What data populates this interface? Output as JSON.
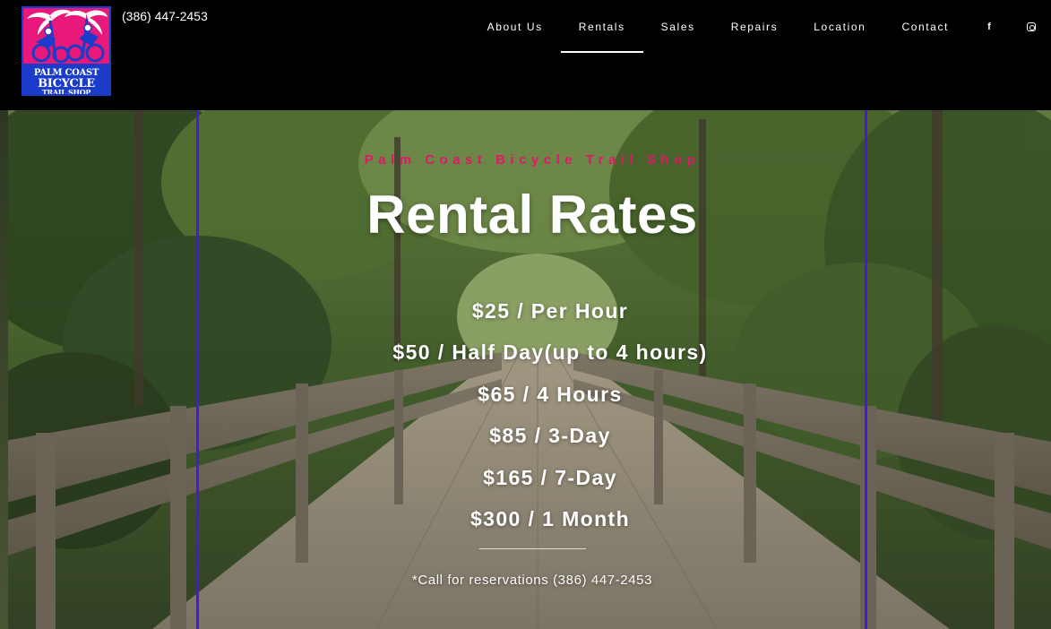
{
  "header": {
    "logo": {
      "line1": "PALM COAST",
      "line2": "BICYCLE",
      "line3": "TRAIL SHOP"
    },
    "phone": "(386) 447-2453",
    "nav": [
      {
        "label": "About Us",
        "active": false
      },
      {
        "label": "Rentals",
        "active": true
      },
      {
        "label": "Sales",
        "active": false
      },
      {
        "label": "Repairs",
        "active": false
      },
      {
        "label": "Location",
        "active": false
      },
      {
        "label": "Contact",
        "active": false
      }
    ],
    "social": {
      "facebook_glyph": "f",
      "facebook_icon": "facebook-icon",
      "instagram_icon": "instagram-icon"
    }
  },
  "hero": {
    "eyebrow": "Palm Coast Bicycle Trail Shop",
    "title": "Rental Rates",
    "rates": [
      "$25 / Per Hour",
      "$50 / Half Day(up to 4 hours)",
      "$65 / 4 Hours",
      "$85 / 3-Day",
      "$165 / 7-Day",
      "$300 / 1 Month"
    ],
    "note": "*Call for reservations (386) 447-2453"
  },
  "colors": {
    "header_bg": "#000000",
    "accent_pink": "#e0176a",
    "frame_line": "#4a17e0",
    "logo_bg": "#e8197a",
    "logo_border": "#1a3cc8"
  }
}
